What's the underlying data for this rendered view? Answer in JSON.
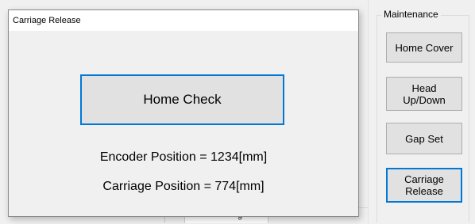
{
  "dialog": {
    "title": "Carriage Release",
    "home_check_label": "Home Check",
    "encoder_position": "Encoder Position = 1234[mm]",
    "carriage_position": "Carriage Position = 774[mm]"
  },
  "maintenance": {
    "group_title": "Maintenance",
    "buttons": [
      {
        "label": "Home Cover"
      },
      {
        "label": "Head Up/Down"
      },
      {
        "label": "Gap Set"
      },
      {
        "label": "Carriage Release"
      }
    ]
  },
  "background": {
    "tab_partial_text": "g"
  },
  "colors": {
    "focus_border": "#0078d7",
    "button_face": "#e1e1e1",
    "window_bg": "#f0f0f0"
  }
}
